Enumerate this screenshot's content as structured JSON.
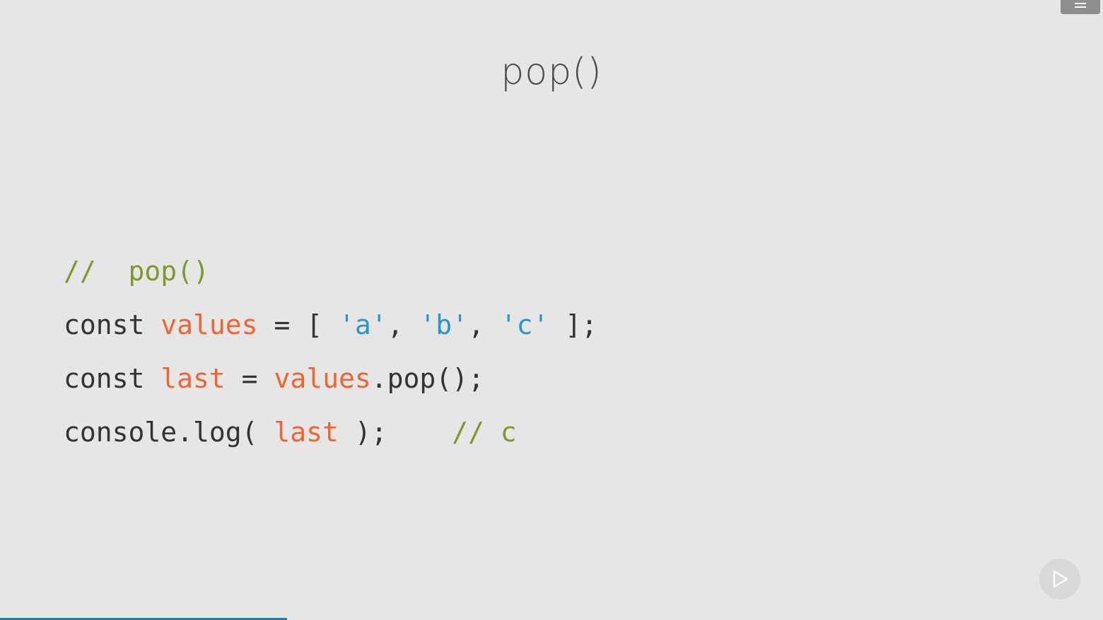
{
  "slide": {
    "title": "pop()"
  },
  "code_lines": [
    [
      {
        "text": "//  pop()",
        "kind": "comment"
      }
    ],
    [
      {
        "text": "const ",
        "kind": "plain"
      },
      {
        "text": "values",
        "kind": "var"
      },
      {
        "text": " = [ ",
        "kind": "plain"
      },
      {
        "text": "'a'",
        "kind": "str"
      },
      {
        "text": ", ",
        "kind": "plain"
      },
      {
        "text": "'b'",
        "kind": "str"
      },
      {
        "text": ", ",
        "kind": "plain"
      },
      {
        "text": "'c'",
        "kind": "str"
      },
      {
        "text": " ];",
        "kind": "plain"
      }
    ],
    [
      {
        "text": "const ",
        "kind": "plain"
      },
      {
        "text": "last",
        "kind": "var"
      },
      {
        "text": " = ",
        "kind": "plain"
      },
      {
        "text": "values",
        "kind": "var"
      },
      {
        "text": ".pop();",
        "kind": "plain"
      }
    ],
    [
      {
        "text": "console.log( ",
        "kind": "plain"
      },
      {
        "text": "last",
        "kind": "var"
      },
      {
        "text": " );    ",
        "kind": "plain"
      },
      {
        "text": "// c",
        "kind": "comment"
      }
    ]
  ],
  "colors": {
    "background": "#e6e6e6",
    "comment": "#7c9a2e",
    "variable": "#ef6532",
    "string": "#2a96c8",
    "plain": "#333333",
    "progress": "#1a7fb5"
  },
  "icons": {
    "menu": "hamburger-menu-icon",
    "next": "play-next-icon"
  },
  "progress": {
    "fraction": 0.26
  }
}
